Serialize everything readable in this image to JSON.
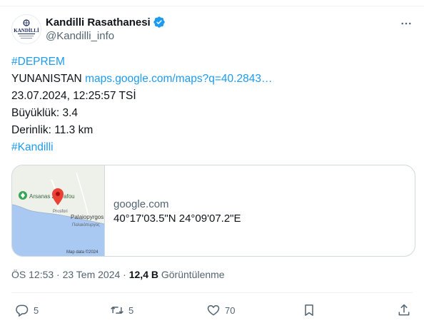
{
  "user": {
    "display_name": "Kandilli Rasathanesi",
    "handle": "@Kandilli_info",
    "avatar_text": "KANDİLLİ",
    "verified_icon": "verified-badge-icon"
  },
  "tweet": {
    "hashtag_1": "#DEPREM",
    "location": "YUNANISTAN",
    "map_link": "maps.google.com/maps?q=40.2843…",
    "datetime": "23.07.2024, 12:25:57 TSİ",
    "magnitude": "Büyüklük: 3.4",
    "depth": "Derinlik: 11.3 km",
    "hashtag_2": "#Kandilli"
  },
  "card": {
    "domain": "google.com",
    "coordinates": "40°17'03.5\"N 24°09'07.2\"E",
    "map_labels": {
      "place_1": "Arsanas Zografou",
      "place_2": "Palaiopyrgos",
      "place_3": "Παλαιόπυργος",
      "road": "Prosfori",
      "copyright": "Map data ©2024"
    }
  },
  "meta": {
    "time": "ÖS 12:53 · 23 Tem 2024 · ",
    "views_count": "12,4 B",
    "views_label": " Görüntülenme"
  },
  "actions": {
    "reply_count": "5",
    "retweet_count": "5",
    "like_count": "70"
  },
  "colors": {
    "link": "#1d9bf0",
    "secondary_text": "#536471",
    "border": "#cfd9de",
    "sea": "#a9c8f2",
    "land": "#eef0ea",
    "pin": "#ea4335"
  }
}
